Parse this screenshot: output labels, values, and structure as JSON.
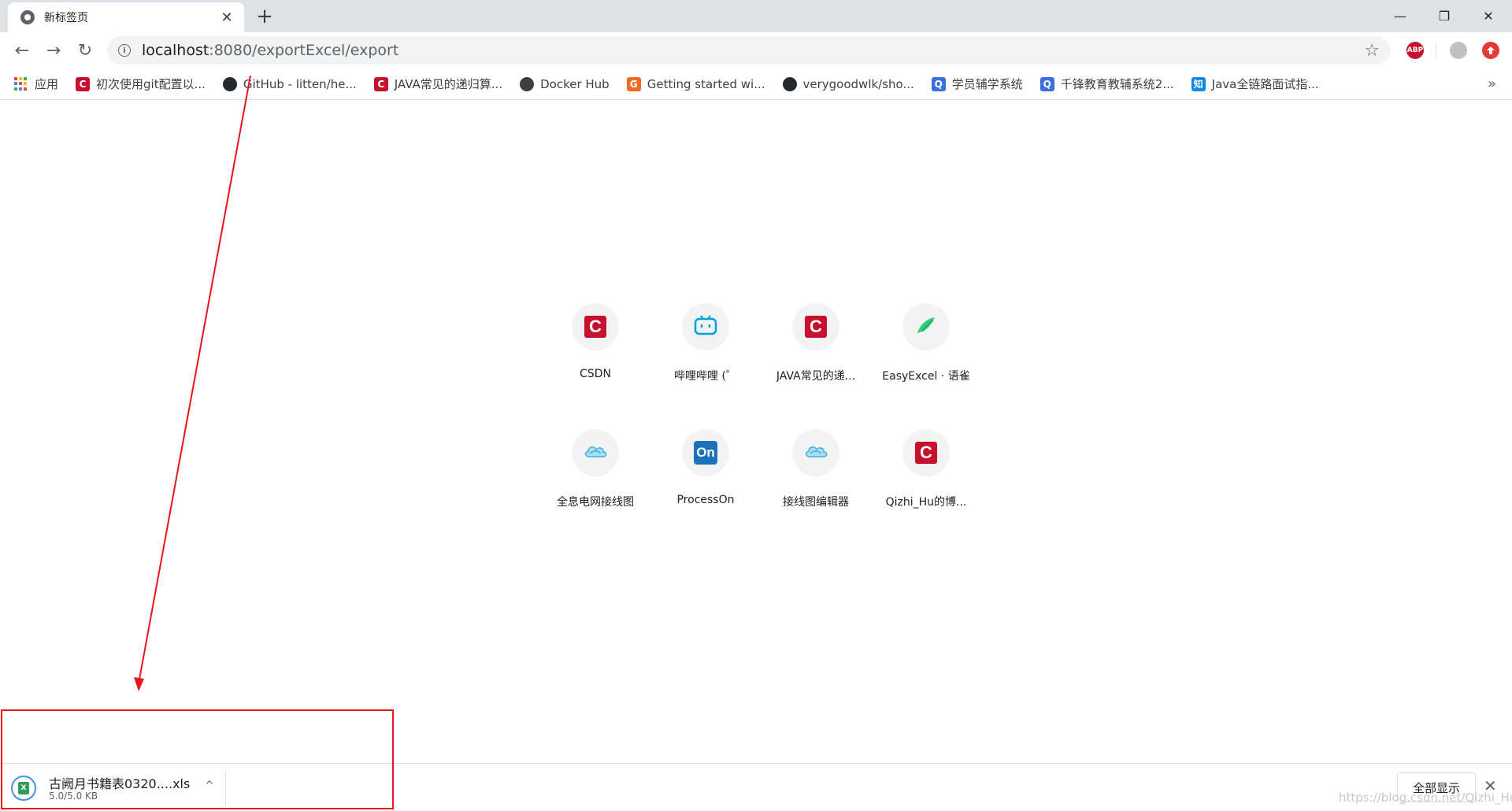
{
  "tab": {
    "title": "新标签页",
    "close": "✕",
    "new_tab": "+"
  },
  "window": {
    "minimize": "—",
    "restore": "❐",
    "close": "✕"
  },
  "toolbar": {
    "back": "←",
    "forward": "→",
    "reload": "↻",
    "url_host": "localhost",
    "url_rest": ":8080/exportExcel/export",
    "info": "i",
    "star": "☆",
    "abp": "ABP"
  },
  "bookmarks": [
    {
      "label": "应用",
      "icon": "apps-icon",
      "color": ""
    },
    {
      "label": "初次使用git配置以...",
      "icon": "csdn-icon",
      "color": "#c8102e"
    },
    {
      "label": "GitHub - litten/he...",
      "icon": "github-icon",
      "color": "#24292e"
    },
    {
      "label": "JAVA常见的递归算...",
      "icon": "csdn-icon",
      "color": "#c8102e"
    },
    {
      "label": "Docker Hub",
      "icon": "docker-icon",
      "color": "#3c4043"
    },
    {
      "label": "Getting started wi...",
      "icon": "gradle-icon",
      "color": "#f26b21"
    },
    {
      "label": "verygoodwlk/sho...",
      "icon": "github-icon",
      "color": "#24292e"
    },
    {
      "label": "学员辅学系统",
      "icon": "qf-icon",
      "color": "#3b6fe0"
    },
    {
      "label": "千锋教育教辅系统2...",
      "icon": "qf-icon",
      "color": "#3b6fe0"
    },
    {
      "label": "Java全链路面试指...",
      "icon": "zhihu-icon",
      "color": "#0f88eb"
    }
  ],
  "bookmarks_more": "»",
  "tiles": [
    {
      "label": "CSDN",
      "icon": "csdn-icon"
    },
    {
      "label": "哔哩哔哩 (゜",
      "icon": "bilibili-icon"
    },
    {
      "label": "JAVA常见的递...",
      "icon": "csdn-icon"
    },
    {
      "label": "EasyExcel · 语雀",
      "icon": "yuque-icon"
    },
    {
      "label": "全息电网接线图",
      "icon": "cloud-icon"
    },
    {
      "label": "ProcessOn",
      "icon": "processon-icon"
    },
    {
      "label": "接线图编辑器",
      "icon": "cloud-icon"
    },
    {
      "label": "Qizhi_Hu的博...",
      "icon": "csdn-icon"
    }
  ],
  "download": {
    "filename": "古阙月书籍表0320....xls",
    "size": "5.0/5.0 KB",
    "chevron": "^",
    "show_all": "全部显示",
    "close": "✕"
  },
  "watermark": "https://blog.csdn.net/Qizhi_Hu",
  "colors": {
    "annotation": "#e8161c",
    "tabstrip": "#dee1e6"
  }
}
